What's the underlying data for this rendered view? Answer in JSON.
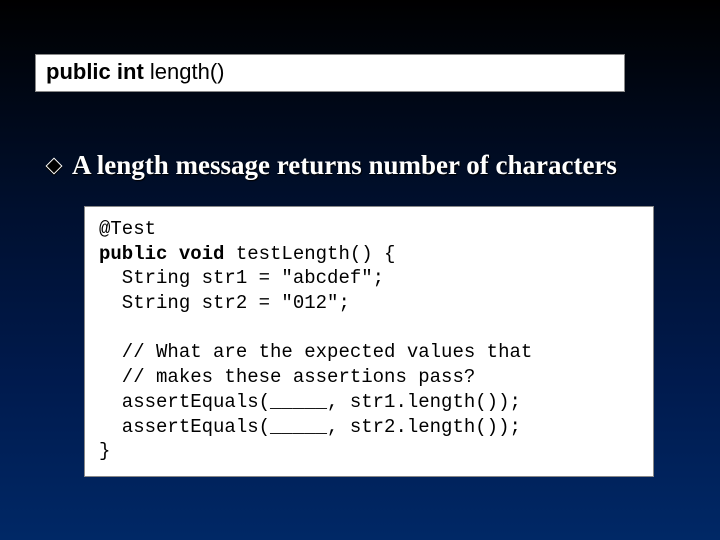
{
  "method": {
    "modifiers": "public int",
    "name": "length()"
  },
  "bullet": {
    "text": "A length message returns number of characters"
  },
  "code": {
    "line1_annotation": "@Test",
    "line2_mods": "public void",
    "line2_rest": " testLength() {",
    "line3": "  String str1 = \"abcdef\";",
    "line4": "  String str2 = \"012\";",
    "blank": "",
    "line5": "  // What are the expected values that",
    "line6": "  // makes these assertions pass?",
    "line7": "  assertEquals(_____, str1.length());",
    "line8": "  assertEquals(_____, str2.length());",
    "line9": "}"
  }
}
